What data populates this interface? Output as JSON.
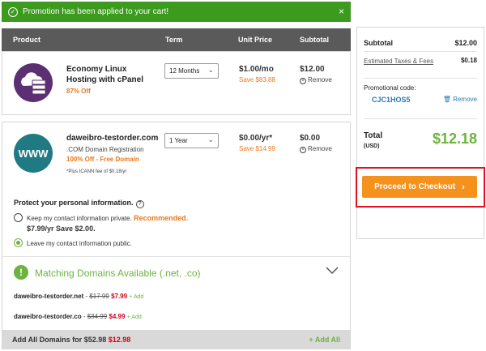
{
  "banner": {
    "text": "Promotion has been applied to your cart!",
    "close": "×"
  },
  "table": {
    "headers": {
      "product": "Product",
      "term": "Term",
      "unit_price": "Unit Price",
      "subtotal": "Subtotal"
    }
  },
  "items": [
    {
      "name_line1": "Economy Linux",
      "name_line2": "Hosting with cPanel",
      "discount": "87% Off",
      "term": "12 Months",
      "price": "$1.00/mo",
      "save": "Save $83.88",
      "subtotal": "$12.00",
      "remove": "Remove"
    },
    {
      "name": "daweibro-testorder.com",
      "desc": ".COM Domain Registration",
      "discount": "100% Off - Free Domain",
      "note": "*Plus ICANN fee of $0.18/yr",
      "term": "1 Year",
      "price": "$0.00/yr*",
      "save": "Save $14.99",
      "subtotal": "$0.00",
      "remove": "Remove"
    }
  ],
  "privacy": {
    "title": "Protect your personal information.",
    "option1_text": "Keep my contact information private.",
    "option1_highlight": "Recommended.",
    "option1_price": "$7.99/yr Save $2.00.",
    "option2_text": "Leave my contact information public."
  },
  "matching": {
    "title": "Matching Domains Available (.net, .co)",
    "domains": [
      {
        "name": "daweibro-testorder.net",
        "sep": " - ",
        "old": "$17.99",
        "new": "$7.99",
        "add": "+ Add"
      },
      {
        "name": "daweibro-testorder.co",
        "sep": " - ",
        "old": "$34.99",
        "new": "$4.99",
        "add": "+ Add"
      }
    ],
    "add_all_prefix": "Add All Domains for",
    "add_all_old": "$52.98",
    "add_all_new": "$12.98",
    "add_all_button": "+ Add All"
  },
  "summary": {
    "subtotal_label": "Subtotal",
    "subtotal_value": "$12.00",
    "taxes_label": "Estimated Taxes & Fees",
    "taxes_value": "$0.18",
    "promo_label": "Promotional code:",
    "promo_code": "CJC1HOS5",
    "promo_remove": "Remove",
    "total_label": "Total",
    "total_currency": "(USD)",
    "total_value": "$12.18",
    "checkout": "Proceed to Checkout"
  },
  "colors": {
    "green": "#6cb33f",
    "banner": "#3c9a1f",
    "orange": "#f5921e",
    "highlight_frame": "#e5101d"
  },
  "icons": {
    "banner": "check-circle-icon",
    "hosting": "hosting-server-icon",
    "domain": "www-globe-icon"
  }
}
